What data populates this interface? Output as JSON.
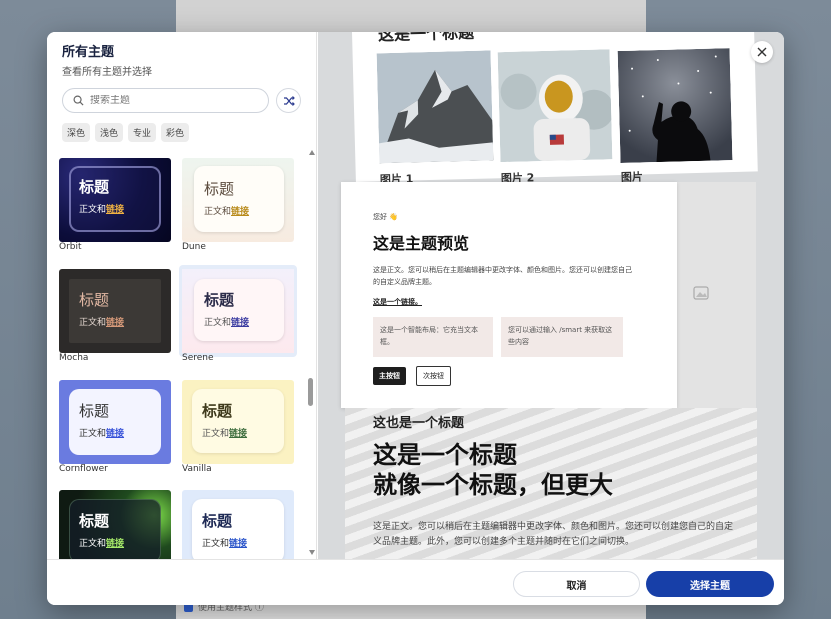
{
  "background": {
    "bottom_text": "使用主题样式 ⓘ"
  },
  "dialog": {
    "title": "所有主题",
    "subtitle": "查看所有主题并选择",
    "search_placeholder": "搜索主题",
    "filters": [
      "深色",
      "浅色",
      "专业",
      "彩色"
    ],
    "card_heading": "标题",
    "card_body": "正文和",
    "card_link": "链接",
    "themes": [
      {
        "name": "Orbit"
      },
      {
        "name": "Dune"
      },
      {
        "name": "Mocha"
      },
      {
        "name": "Serene"
      },
      {
        "name": "Cornflower"
      },
      {
        "name": "Vanilla"
      },
      {
        "name": ""
      },
      {
        "name": ""
      }
    ],
    "cancel_label": "取消",
    "select_label": "选择主题"
  },
  "preview": {
    "slide1_title": "这是一个标题",
    "captions": [
      "图片 1",
      "图片 2",
      "图片"
    ],
    "slide2": {
      "hello": "您好 👋",
      "title": "这是主题预览",
      "body": "这是正文。您可以稍后在主题编辑器中更改字体、颜色和图片。您还可以创建您自己的自定义品牌主题。",
      "link": "这是一个链接。",
      "box1": "这是一个智能布局：它充当文本框。",
      "box2": "您可以通过输入 /smart 来获取这些内容",
      "primary": "主按钮",
      "secondary": "次按钮"
    },
    "slide3": {
      "kicker": "这也是一个标题",
      "big1": "这是一个标题",
      "big2": "就像一个标题，但更大",
      "body": "这是正文。您可以稍后在主题编辑器中更改字体、颜色和图片。您还可以创建您自己的自定义品牌主题。此外，您可以创建多个主题并随时在它们之间切换。"
    }
  }
}
